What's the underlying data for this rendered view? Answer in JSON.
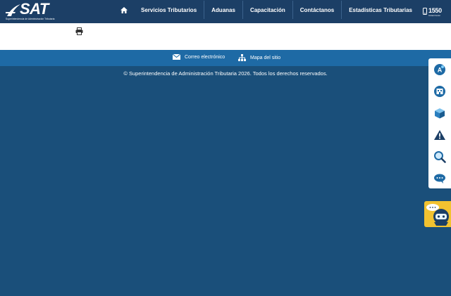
{
  "header": {
    "logo": {
      "word": "SAT",
      "subtitle": "Superintendencia de Administración Tributaria"
    },
    "nav": [
      {
        "label": "Servicios Tributarios"
      },
      {
        "label": "Aduanas"
      },
      {
        "label": "Capacitación"
      },
      {
        "label": "Contáctanos"
      },
      {
        "label": "Estadísticas Tributarias"
      }
    ],
    "phone": {
      "number": "1550",
      "sub": "Contact Center"
    },
    "icons": {
      "home": "home-icon",
      "phone": "phone-icon"
    }
  },
  "content": {
    "print_icon": "print-icon"
  },
  "footer": {
    "links": [
      {
        "label": "Correo electrónico",
        "icon": "mail-icon"
      },
      {
        "label": "Mapa del sitio",
        "icon": "sitemap-icon"
      }
    ],
    "copyright": "© Superintendencia de Administración Tributaria 2026. Todos los derechos reservados."
  },
  "side_panel": {
    "buttons": [
      "accessibility-icon",
      "agency-icon",
      "cube-icon",
      "warning-icon",
      "search-icon",
      "chat-bubbles-icon"
    ]
  },
  "chat_widget": {
    "icon": "chat-assistant-icon"
  },
  "colors": {
    "topbar": "#1c3f66",
    "body": "#1a4f7a",
    "footer_bar": "#1e6aa5",
    "chat_button": "#f2c230"
  }
}
